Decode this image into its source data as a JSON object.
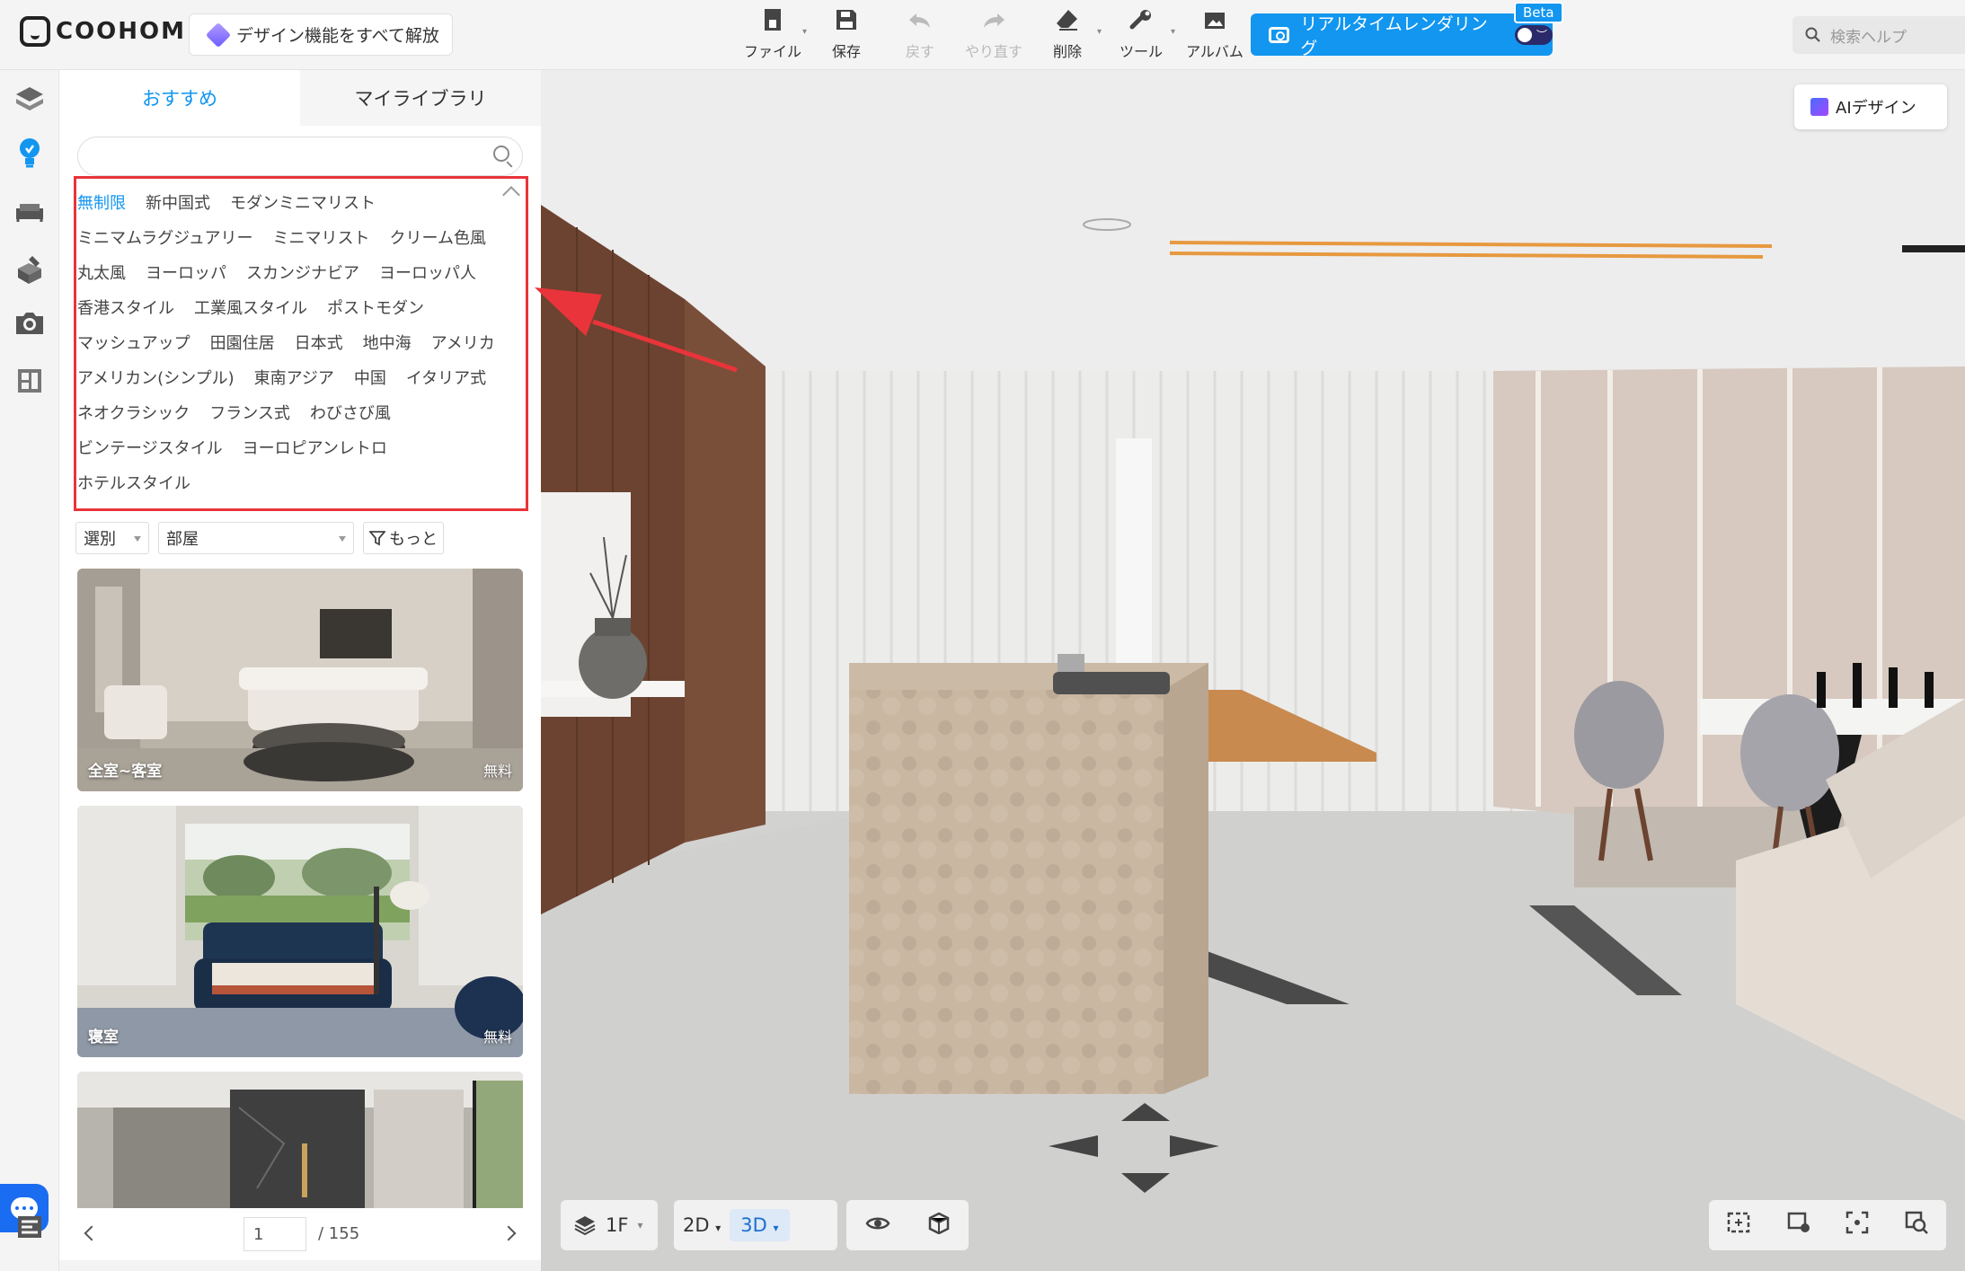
{
  "app": {
    "logo": "COOHOM",
    "unlock_label": "デザイン機能をすべて解放"
  },
  "toolbar": {
    "items": [
      {
        "label": "ファイル",
        "icon": "file-icon",
        "disabled": false,
        "has_caret": true
      },
      {
        "label": "保存",
        "icon": "save-icon",
        "disabled": false,
        "has_caret": false
      },
      {
        "label": "戻す",
        "icon": "undo-icon",
        "disabled": true,
        "has_caret": false
      },
      {
        "label": "やり直す",
        "icon": "redo-icon",
        "disabled": true,
        "has_caret": false
      },
      {
        "label": "削除",
        "icon": "eraser-icon",
        "disabled": false,
        "has_caret": true
      },
      {
        "label": "ツール",
        "icon": "wrench-icon",
        "disabled": false,
        "has_caret": true
      },
      {
        "label": "アルバム",
        "icon": "album-icon",
        "disabled": false,
        "has_caret": false
      }
    ],
    "render_label": "リアルタイムレンダリング",
    "beta": "Beta",
    "help_placeholder": "検索ヘルプ",
    "accent": "#1296f0"
  },
  "rail": {
    "items": [
      {
        "icon": "floorplan-icon",
        "active": false
      },
      {
        "icon": "inspiration-bulb-icon",
        "active": true
      },
      {
        "icon": "furniture-sofa-icon",
        "active": false
      },
      {
        "icon": "build-tools-icon",
        "active": false
      },
      {
        "icon": "camera-icon",
        "active": false
      },
      {
        "icon": "template-icon",
        "active": false
      }
    ]
  },
  "panel": {
    "tabs": [
      {
        "label": "おすすめ",
        "active": true
      },
      {
        "label": "マイライブラリ",
        "active": false
      }
    ],
    "search_placeholder": "",
    "styles": [
      [
        "無制限",
        "新中国式",
        "モダンミニマリスト"
      ],
      [
        "ミニマムラグジュアリー",
        "ミニマリスト",
        "クリーム色風"
      ],
      [
        "丸太風",
        "ヨーロッパ",
        "スカンジナビア",
        "ヨーロッパ人"
      ],
      [
        "香港スタイル",
        "工業風スタイル",
        "ポストモダン"
      ],
      [
        "マッシュアップ",
        "田園住居",
        "日本式",
        "地中海",
        "アメリカ"
      ],
      [
        "アメリカン(シンプル)",
        "東南アジア",
        "中国",
        "イタリア式"
      ],
      [
        "ネオクラシック",
        "フランス式",
        "わびさび風"
      ],
      [
        "ビンテージスタイル",
        "ヨーロピアンレトロ"
      ],
      [
        "ホテルスタイル"
      ]
    ],
    "selected_style": "無制限",
    "filter_select1": "選別",
    "filter_select2": "部屋",
    "more_label": "もっと",
    "cards": [
      {
        "caption": "全室~客室",
        "badge": "無料"
      },
      {
        "caption": "寝室",
        "badge": "無料"
      },
      {
        "caption": "",
        "badge": ""
      }
    ],
    "pager": {
      "current": "1",
      "total": "/ 155"
    }
  },
  "viewport": {
    "ai_label": "AIデザイン",
    "floor_label": "1F",
    "view_2d": "2D",
    "view_3d": "3D",
    "active_view": "3D"
  }
}
